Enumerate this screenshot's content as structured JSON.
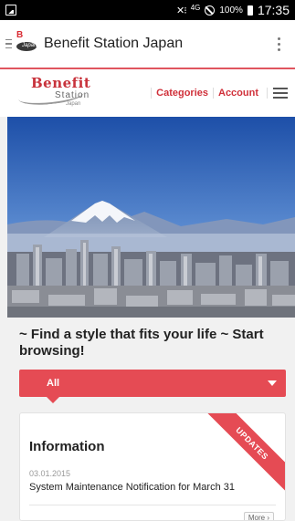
{
  "status_bar": {
    "network": "4G",
    "battery": "100%",
    "time": "17:35"
  },
  "app_bar": {
    "title": "Benefit Station Japan"
  },
  "site_header": {
    "brand_word": "Benefit",
    "brand_sub": "Station",
    "brand_tag": "Japan",
    "nav": [
      {
        "label": "Categories"
      },
      {
        "label": "Account"
      }
    ]
  },
  "hero": {
    "alt": "Mount Fuji over Tokyo skyline"
  },
  "tagline": "~ Find a style that fits your life ~ Start browsing!",
  "filter": {
    "selected": "All"
  },
  "info_card": {
    "ribbon": "UPDATES",
    "heading": "Information",
    "date": "03.01.2015",
    "item": "System Maintenance Notification for March 31",
    "more": "More"
  },
  "colors": {
    "accent": "#e54b54",
    "brand_red": "#c8323b"
  }
}
